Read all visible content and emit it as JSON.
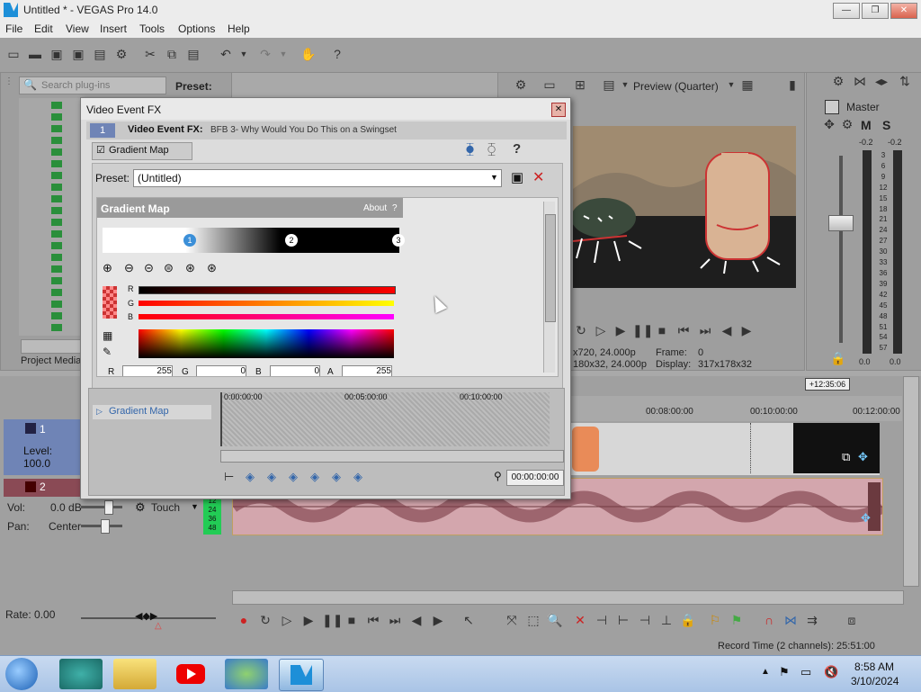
{
  "window": {
    "title": "Untitled * - VEGAS Pro 14.0"
  },
  "menu": [
    "File",
    "Edit",
    "View",
    "Insert",
    "Tools",
    "Options",
    "Help"
  ],
  "explorer": {
    "search_placeholder": "Search plug-ins",
    "preset_label": "Preset:",
    "tab_label": "Project Media"
  },
  "preview": {
    "mode": "Preview (Quarter)",
    "info_proj": "x720, 24.000p",
    "info_frame_label": "Frame:",
    "info_frame": "0",
    "info_preview": "180x32, 24.000p",
    "info_display_label": "Display:",
    "info_display": "317x178x32"
  },
  "master": {
    "label": "Master",
    "m": "M",
    "s": "S",
    "db_left": "-0.2",
    "db_right": "-0.2",
    "scale": [
      "3",
      "6",
      "9",
      "12",
      "15",
      "18",
      "21",
      "24",
      "27",
      "30",
      "33",
      "36",
      "39",
      "42",
      "45",
      "48",
      "51",
      "54",
      "57"
    ],
    "foot_left": "0.0",
    "foot_right": "0.0"
  },
  "dialog": {
    "title": "Video Event FX",
    "header_prefix": "Video Event FX:",
    "header_event": "BFB 3- Why Would You Do This on a Swingset",
    "track_index": "1",
    "chain_item": "Gradient Map",
    "preset_label": "Preset:",
    "preset_value": "(Untitled)",
    "panel_title": "Gradient Map",
    "about": "About",
    "help": "?",
    "stops": [
      "1",
      "2",
      "3"
    ],
    "channels": {
      "r": "R",
      "g": "G",
      "b": "B"
    },
    "rgba_labels": [
      "R",
      "G",
      "B",
      "A"
    ],
    "rgba_values": [
      "255",
      "0",
      "0",
      "255"
    ],
    "keyframe_track": "Gradient Map",
    "ruler": [
      "0:00:00:00",
      "00:05:00:00",
      "00:10:00:00"
    ],
    "timecode": "00:00:00:00"
  },
  "timeline": {
    "timecode_badge": "+12:35:06",
    "ruler": [
      "00:08:00:00",
      "00:10:00:00",
      "00:12:00:00"
    ],
    "track1": {
      "num": "1",
      "level": "Level: 100.0"
    },
    "track2": {
      "num": "2",
      "vol_label": "Vol:",
      "vol_value": "0.0 dB",
      "pan_label": "Pan:",
      "pan_value": "Center",
      "touch": "Touch"
    },
    "rate": "Rate: 0.00",
    "record_time": "Record Time (2 channels): 25:51:00",
    "meter_scale": [
      "12",
      "24",
      "36",
      "48"
    ]
  },
  "taskbar": {
    "time": "8:58 AM",
    "date": "3/10/2024"
  },
  "colors": {
    "accent": "#1d8fd8",
    "audio": "#d3a6ad",
    "dialog": "#dcdcdc"
  }
}
